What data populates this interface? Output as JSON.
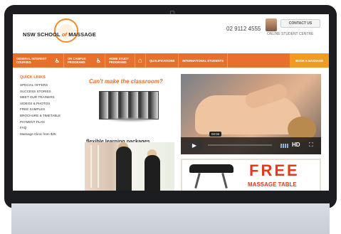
{
  "site": {
    "logo": {
      "prefix": "NSW SCHOOL",
      "of": "of",
      "suffix": "MASSAGE"
    },
    "phone": "02 9112 4555",
    "contact_label": "CONTACT US",
    "online_label": "ONLINE STUDENT CENTRE"
  },
  "nav": {
    "items": [
      {
        "label": "GENERAL INTEREST COURSES"
      },
      {
        "label": "ON CAMPUS PROGRAMS"
      },
      {
        "label": "HOME STUDY PROGRAMS"
      },
      {
        "label": "QUALIFICATIONS"
      },
      {
        "label": "INTERNATIONAL STUDENTS"
      }
    ],
    "book_label": "BOOK A MASSAGE",
    "home_icon": "home-icon",
    "person_icon": "massage-person-icon"
  },
  "sidebar": {
    "title": "QUICK LINKS",
    "links": [
      "SPECIAL OFFERS",
      "SUCCESS STORIES",
      "MEET OUR TRAINERS",
      "VIDEOS & PHOTOS",
      "FREE SAMPLES",
      "BROCHURE & TIMETABLE",
      "PAYMENT PLAN",
      "FAQ",
      "Massage Clinic from $25"
    ]
  },
  "promo": {
    "question": "Can't make the classroom?",
    "caption": "flexible learning packages"
  },
  "video": {
    "time": "02:02",
    "hd_label": "HD"
  },
  "free_banner": {
    "big": "FREE",
    "small": "MASSAGE TABLE"
  },
  "colors": {
    "nav_orange": "#e8702a",
    "book_orange": "#f39b1e",
    "free_red": "#e23b1b"
  }
}
